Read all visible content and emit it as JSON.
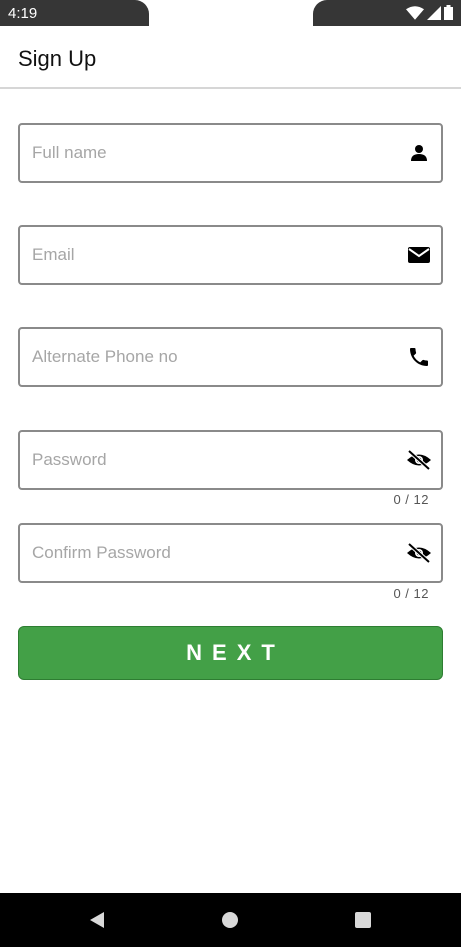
{
  "status_bar": {
    "time": "4:19",
    "icons": [
      "wifi-icon",
      "signal-icon",
      "battery-icon"
    ]
  },
  "app_bar": {
    "title": "Sign Up"
  },
  "form": {
    "full_name": {
      "placeholder": "Full name",
      "value": "",
      "icon": "person-icon"
    },
    "email": {
      "placeholder": "Email",
      "value": "",
      "icon": "mail-icon"
    },
    "alt_phone": {
      "placeholder": "Alternate Phone no",
      "value": "",
      "icon": "phone-icon"
    },
    "password": {
      "placeholder": "Password",
      "value": "",
      "icon": "visibility-off-icon",
      "counter": "0 / 12"
    },
    "confirm_password": {
      "placeholder": "Confirm Password",
      "value": "",
      "icon": "visibility-off-icon",
      "counter": "0 / 12"
    }
  },
  "next_button": {
    "label": "NEXT",
    "color": "#43a047"
  },
  "nav_bar": {
    "buttons": [
      "back-icon",
      "home-icon",
      "recents-icon"
    ]
  }
}
